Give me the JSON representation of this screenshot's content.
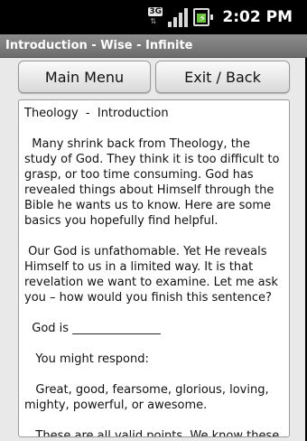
{
  "status_bar": {
    "network": "3G",
    "time": "2:02",
    "period": "PM",
    "icons": [
      "network-3g-icon",
      "signal-strength-icon",
      "battery-charging-icon"
    ],
    "battery_color": "#6ac23a"
  },
  "title_bar": {
    "title": "Introduction - Wise - Infinite"
  },
  "buttons": {
    "main_menu": "Main Menu",
    "exit_back": "Exit / Back"
  },
  "content": {
    "heading": "Theology  -  Introduction",
    "paragraphs": [
      "  Many shrink back from Theology, the study of God. They think it is too difficult to grasp, or too time consuming. God has revealed things about Himself through the Bible he wants us to know. Here are some basics you hopefully find helpful.",
      " Our God is unfathomable. Yet He reveals Himself to us in a limited way. It is that revelation we want to examine. Let me ask you – how would you finish this sentence?",
      "  God is _______________",
      "   You might respond:",
      "   Great, good, fearsome, glorious, loving, mighty, powerful, or awesome.",
      "   These are all valid points. We know these things about God, because He has revealed"
    ]
  },
  "colors": {
    "title_bar": "#7c7c7c",
    "app_background": "#e9e9e9",
    "content_background": "#ffffff"
  }
}
